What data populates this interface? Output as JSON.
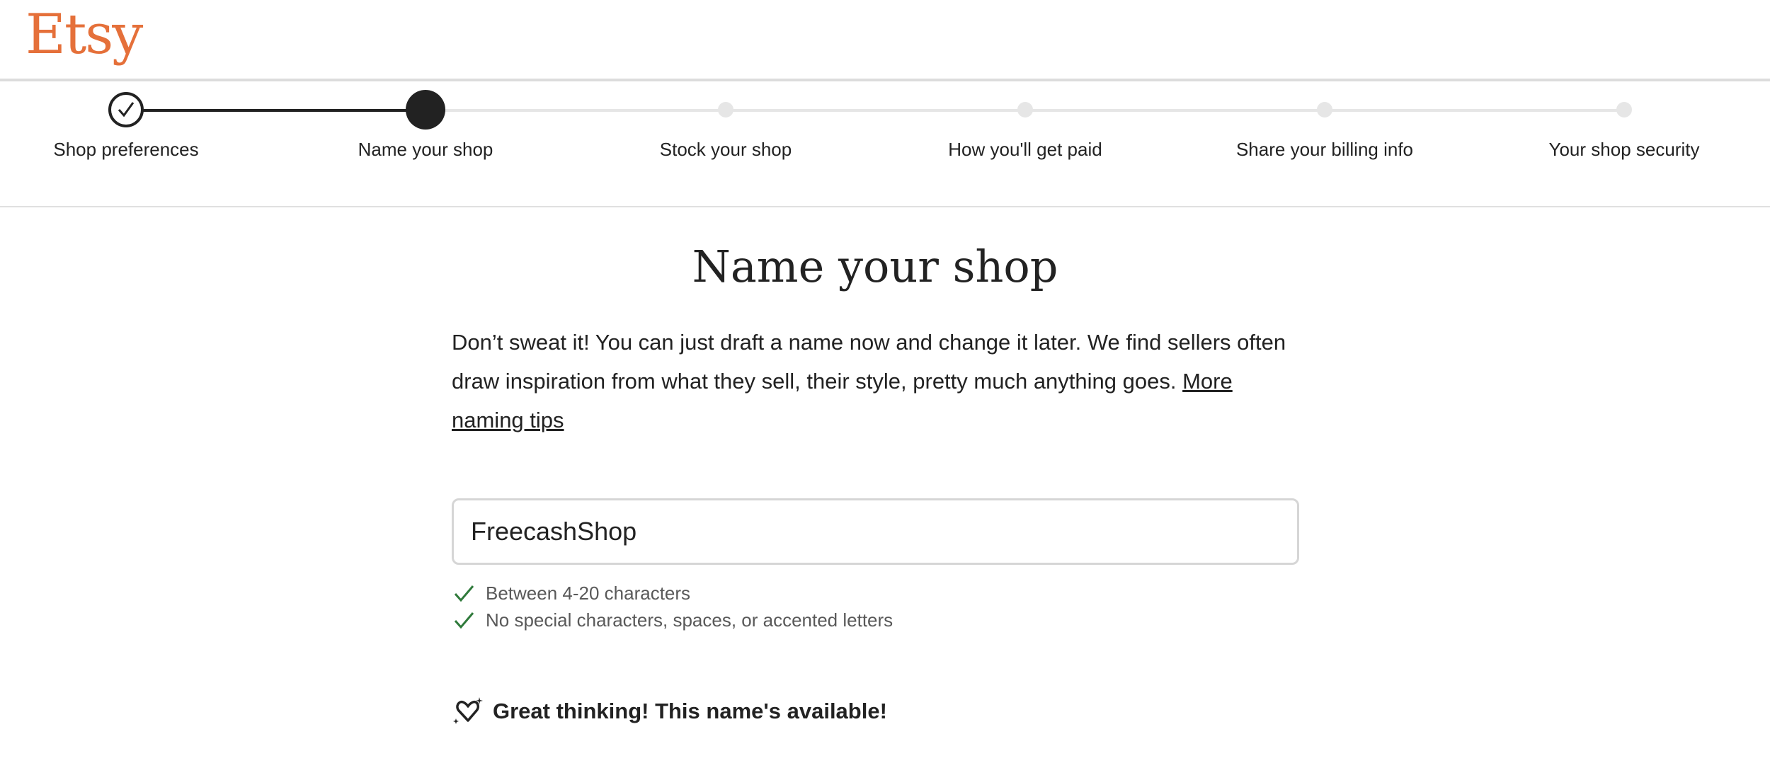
{
  "brand": {
    "logo": "Etsy",
    "color": "#E5703A"
  },
  "stepper": {
    "steps": [
      {
        "label": "Shop preferences",
        "state": "done"
      },
      {
        "label": "Name your shop",
        "state": "current"
      },
      {
        "label": "Stock your shop",
        "state": "todo"
      },
      {
        "label": "How you'll get paid",
        "state": "todo"
      },
      {
        "label": "Share your billing info",
        "state": "todo"
      },
      {
        "label": "Your shop security",
        "state": "todo"
      }
    ]
  },
  "main": {
    "title": "Name your shop",
    "description": "Don’t sweat it! You can just draft a name now and change it later. We find sellers often draw inspiration from what they sell, their style, pretty much anything goes.",
    "tips_link": "More naming tips",
    "shop_name_value": "FreecashShop",
    "rules": [
      {
        "text": "Between 4-20 characters",
        "icon": "check-icon",
        "color": "#2F7A3B"
      },
      {
        "text": "No special characters, spaces, or accented letters",
        "icon": "check-icon",
        "color": "#2F7A3B"
      }
    ],
    "availability": {
      "text": "Great thinking! This name's available!",
      "icon": "sparkle-heart-icon"
    }
  }
}
